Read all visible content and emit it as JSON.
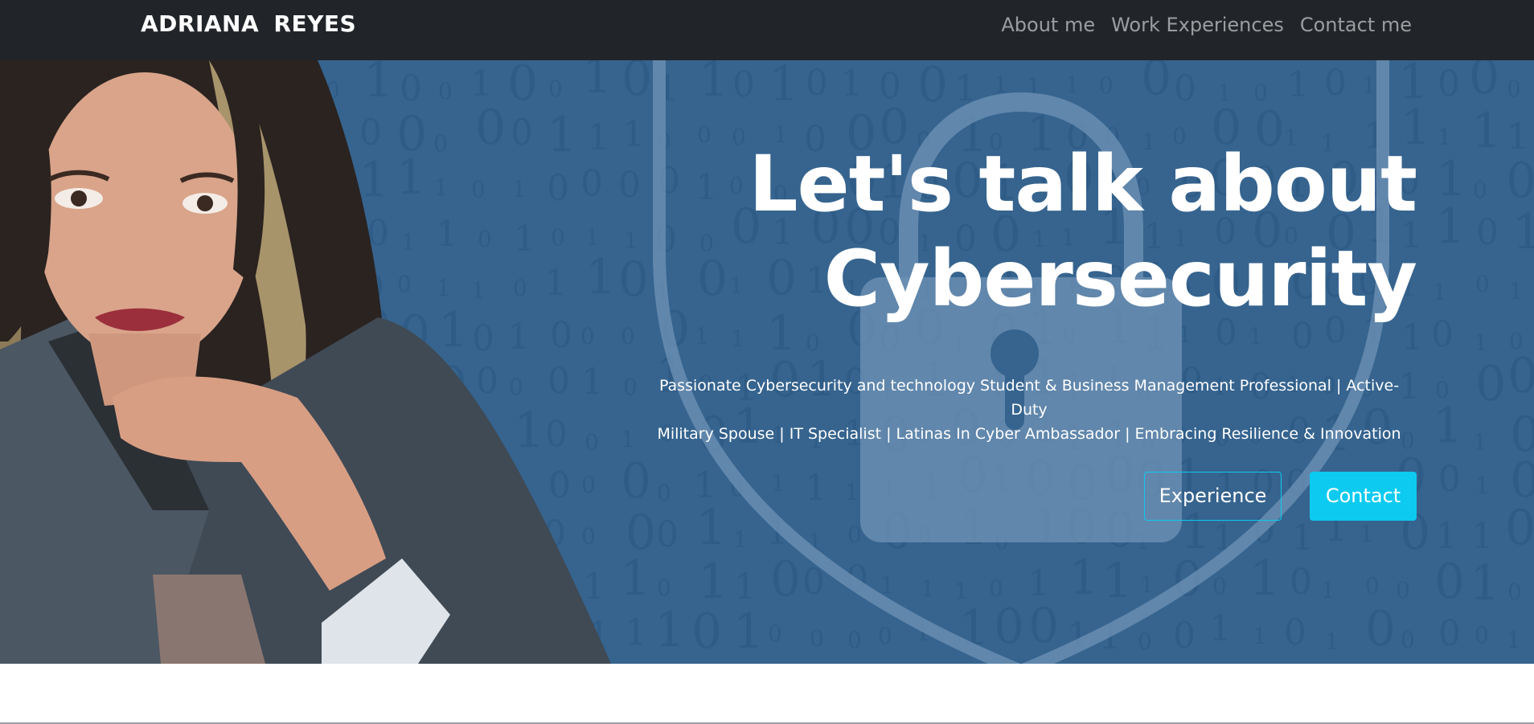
{
  "navbar": {
    "brand": "ADRIANA REYES",
    "links": [
      {
        "label": "About me"
      },
      {
        "label": "Work Experiences"
      },
      {
        "label": "Contact me"
      }
    ],
    "background": "#212529"
  },
  "hero": {
    "title_line1": "Let's talk about",
    "title_line2": "Cybersecurity",
    "subtitle_line1": "Passionate Cybersecurity and technology Student & Business Management Professional | Active-Duty",
    "subtitle_line2": "Military Spouse | IT Specialist | Latinas In Cyber Ambassador | Embracing Resilience & Innovation",
    "buttons": {
      "experience": "Experience",
      "contact": "Contact"
    },
    "background_color": "#36648f",
    "accent_color": "#0dcaf0",
    "background_icons": [
      "shield-icon",
      "padlock-icon",
      "binary-digits"
    ]
  }
}
